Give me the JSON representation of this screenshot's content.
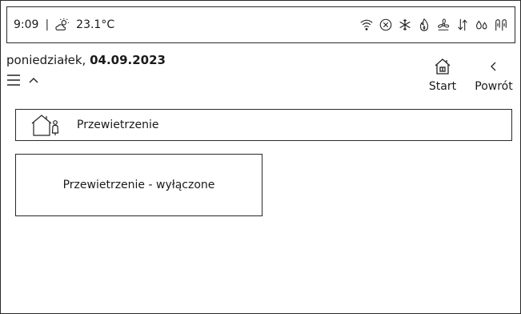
{
  "status_bar": {
    "time": "9:09",
    "separator": "|",
    "temperature": "23.1°C",
    "weather_icon": "partly-sunny-icon",
    "icons": [
      "wifi-icon",
      "x-circle-icon",
      "snowflake-icon",
      "flame-icon",
      "fan-icon",
      "exchange-arrows-icon",
      "drops-icon",
      "pump-icon"
    ]
  },
  "header": {
    "day_name": "poniedziałek,",
    "date": "04.09.2023",
    "menu_icon": "hamburger-icon",
    "collapse_icon": "chevron-up-icon"
  },
  "nav": {
    "start_label": "Start",
    "back_label": "Powrót"
  },
  "breadcrumb": {
    "icon": "house-person-icon",
    "label": "Przewietrzenie"
  },
  "tile": {
    "label": "Przewietrzenie - wyłączone"
  }
}
